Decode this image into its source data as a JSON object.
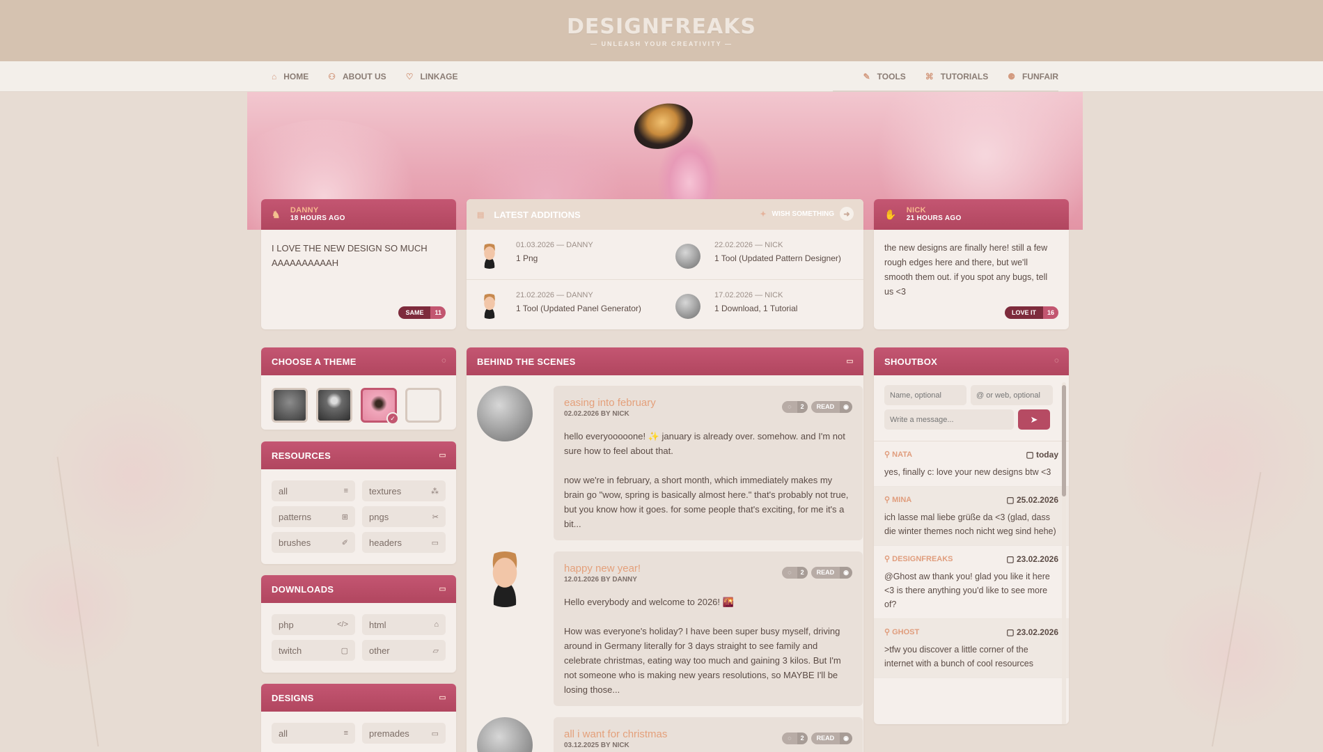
{
  "site": {
    "logo": "DESIGNFREAKS",
    "tagline": "— UNLEASH YOUR CREATIVITY —"
  },
  "nav": {
    "left": [
      {
        "label": "HOME",
        "icon": "home-icon",
        "glyph": "⌂"
      },
      {
        "label": "ABOUT US",
        "icon": "users-icon",
        "glyph": "⚇"
      },
      {
        "label": "LINKAGE",
        "icon": "heart-icon",
        "glyph": "♡"
      }
    ],
    "right": [
      {
        "label": "TOOLS",
        "icon": "brush-icon",
        "glyph": "✎"
      },
      {
        "label": "TUTORIALS",
        "icon": "graduation-cap-icon",
        "glyph": "⌘"
      },
      {
        "label": "FUNFAIR",
        "icon": "gamepad-icon",
        "glyph": "⚈"
      }
    ]
  },
  "status_left": {
    "name": "DANNY",
    "time": "18 HOURS AGO",
    "text": "I LOVE THE NEW DESIGN SO MUCH AAAAAAAAAAH",
    "react_label": "SAME",
    "react_count": "11"
  },
  "status_right": {
    "name": "NICK",
    "time": "21 HOURS AGO",
    "text": "the new designs are finally here! still a few rough edges here and there, but we'll smooth them out. if you spot any bugs, tell us <3",
    "react_label": "LOVE IT",
    "react_count": "16"
  },
  "latest": {
    "title": "LATEST ADDITIONS",
    "wish": "WISH SOMETHING",
    "items": [
      {
        "meta": "01.03.2026 — DANNY",
        "desc": "1 Png",
        "avatar": "danny"
      },
      {
        "meta": "22.02.2026 — NICK",
        "desc": "1 Tool (Updated Pattern Designer)",
        "avatar": "nick"
      },
      {
        "meta": "21.02.2026 — DANNY",
        "desc": "1 Tool (Updated Panel Generator)",
        "avatar": "danny"
      },
      {
        "meta": "17.02.2026 — NICK",
        "desc": "1 Download, 1 Tutorial",
        "avatar": "nick"
      }
    ]
  },
  "themes": {
    "title": "CHOOSE A THEME"
  },
  "resources": {
    "title": "RESOURCES",
    "items": [
      {
        "label": "all",
        "glyph": "≡"
      },
      {
        "label": "textures",
        "glyph": "⁂"
      },
      {
        "label": "patterns",
        "glyph": "⊞"
      },
      {
        "label": "pngs",
        "glyph": "✂"
      },
      {
        "label": "brushes",
        "glyph": "✐"
      },
      {
        "label": "headers",
        "glyph": "▭"
      }
    ]
  },
  "downloads": {
    "title": "DOWNLOADS",
    "items": [
      {
        "label": "php",
        "glyph": "</>"
      },
      {
        "label": "html",
        "glyph": "⌂"
      },
      {
        "label": "twitch",
        "glyph": "▢"
      },
      {
        "label": "other",
        "glyph": "▱"
      }
    ]
  },
  "designs": {
    "title": "DESIGNS",
    "items": [
      {
        "label": "all",
        "glyph": "≡"
      },
      {
        "label": "premades",
        "glyph": "▭"
      }
    ]
  },
  "blog": {
    "title": "BEHIND THE SCENES",
    "posts": [
      {
        "title": "easing into february",
        "date": "02.02.2026 BY NICK",
        "comments": "2",
        "read": "READ",
        "text": "hello everyooooone! ✨ january is already over. somehow. and I'm not sure how to feel about that.\n\nnow we're in february, a short month, which immediately makes my brain go \"wow, spring is basically almost here.\" that's probably not true, but you know how it goes. for some people that's exciting, for me it's a bit..."
      },
      {
        "title": "happy new year!",
        "date": "12.01.2026 BY DANNY",
        "comments": "2",
        "read": "READ",
        "text": "Hello everybody and welcome to 2026! 🌇\n\nHow was everyone's holiday? I have been super busy myself, driving around in Germany literally for 3 days straight to see family and celebrate christmas, eating way too much and gaining 3 kilos. But I'm not someone who is making new years resolutions, so MAYBE I'll be losing those..."
      },
      {
        "title": "all i want for christmas",
        "date": "03.12.2025 BY NICK",
        "comments": "2",
        "read": "READ",
        "text": ""
      }
    ]
  },
  "shoutbox": {
    "title": "SHOUTBOX",
    "name_placeholder": "Name, optional",
    "web_placeholder": "@ or web, optional",
    "msg_placeholder": "Write a message...",
    "shouts": [
      {
        "name": "NATA",
        "date": "today",
        "text": "yes, finally c: love your new designs btw <3"
      },
      {
        "name": "MINA",
        "date": "25.02.2026",
        "text": "ich lasse mal liebe grüße da <3 (glad, dass die winter themes noch nicht weg sind hehe)"
      },
      {
        "name": "DESIGNFREAKS",
        "date": "23.02.2026",
        "text": "@Ghost aw thank you! glad you like it here <3 is there anything you'd like to see more of?"
      },
      {
        "name": "GHOST",
        "date": "23.02.2026",
        "text": ">tfw you discover a little corner of the internet with a bunch of cool resources"
      }
    ]
  },
  "colors": {
    "accent": "#b64b63",
    "header_bg": "#d5c2b0",
    "link": "#e4a07b"
  }
}
